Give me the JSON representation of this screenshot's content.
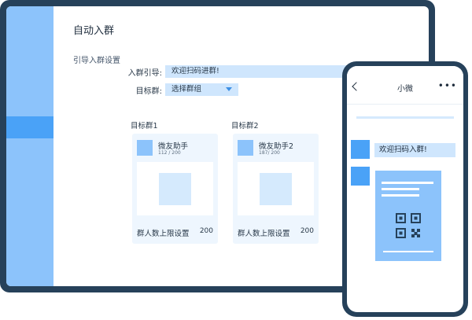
{
  "page": {
    "title": "自动入群",
    "section_title": "引导入群设置"
  },
  "form": {
    "greeting_label": "入群引导:",
    "greeting_value": "欢迎扫码进群!",
    "target_label": "目标群:",
    "target_select_value": "选择群组"
  },
  "groups": [
    {
      "header": "目标群1",
      "name": "微友助手",
      "count": "112 / 200",
      "limit_label": "群人数上限设置",
      "limit_value": "200"
    },
    {
      "header": "目标群2",
      "name": "微友助手2",
      "count": "187/ 200",
      "limit_label": "群人数上限设置",
      "limit_value": "200"
    }
  ],
  "phone": {
    "title": "小微",
    "more_symbol": "•••",
    "message": "欢迎扫码入群!"
  },
  "colors": {
    "frame": "#26415a",
    "sidebar": "#8cc3fb",
    "sidebar_active": "#4aa2f7",
    "input_bg": "#cfe6fd",
    "card_bg": "#eef6fe"
  },
  "icons": {
    "back": "chevron-left-icon",
    "more": "more-dots-icon",
    "qr": "qr-code-icon",
    "dropdown": "caret-down-icon"
  }
}
